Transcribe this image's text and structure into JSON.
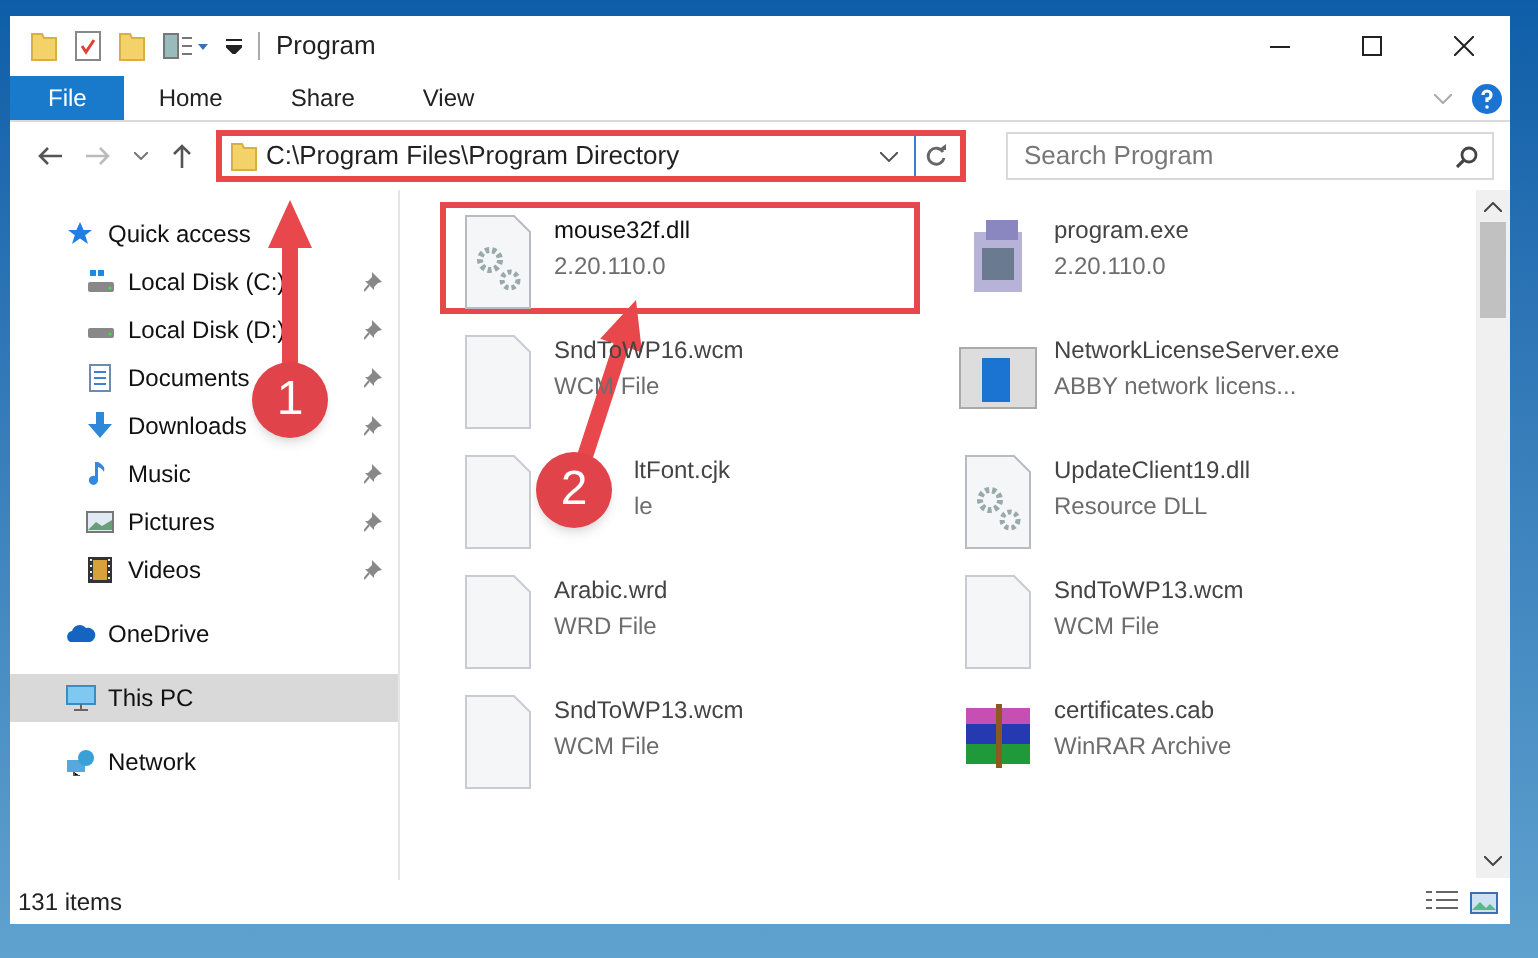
{
  "window": {
    "title": "Program"
  },
  "ribbon_tabs": [
    {
      "label": "File",
      "selected": true
    },
    {
      "label": "Home",
      "selected": false
    },
    {
      "label": "Share",
      "selected": false
    },
    {
      "label": "View",
      "selected": false
    }
  ],
  "address_bar": {
    "path": "C:\\Program Files\\Program Directory",
    "highlighted": true
  },
  "search": {
    "placeholder": "Search Program"
  },
  "sidebar": {
    "items": [
      {
        "label": "Quick access",
        "selected": false,
        "children": [
          {
            "label": "Local Disk (C:)",
            "pinned": true,
            "selected": false
          },
          {
            "label": "Local Disk (D:)",
            "pinned": true,
            "selected": false
          },
          {
            "label": "Documents",
            "pinned": true,
            "selected": false
          },
          {
            "label": "Downloads",
            "pinned": true,
            "selected": false
          },
          {
            "label": "Music",
            "pinned": true,
            "selected": false
          },
          {
            "label": "Pictures",
            "pinned": true,
            "selected": false
          },
          {
            "label": "Videos",
            "pinned": true,
            "selected": false
          }
        ]
      },
      {
        "label": "OneDrive",
        "selected": false
      },
      {
        "label": "This PC",
        "selected": true
      },
      {
        "label": "Network",
        "selected": false
      }
    ]
  },
  "files": [
    {
      "name": "mouse32f.dll",
      "detail": "2.20.110.0",
      "kind": "gearfile",
      "highlighted": true
    },
    {
      "name": "program.exe",
      "detail": "2.20.110.0",
      "kind": "app",
      "highlighted": false
    },
    {
      "name": "SndToWP16.wcm",
      "detail": "WCM File",
      "kind": "blank",
      "highlighted": false
    },
    {
      "name": "NetworkLicenseServer.exe",
      "detail": "ABBY network licens...",
      "kind": "window",
      "highlighted": false
    },
    {
      "name": "ltFont.cjk",
      "detail": "le",
      "kind": "covered",
      "highlighted": false
    },
    {
      "name": "UpdateClient19.dll",
      "detail": "Resource DLL",
      "kind": "gearfile",
      "highlighted": false
    },
    {
      "name": "Arabic.wrd",
      "detail": "WRD File",
      "kind": "blank",
      "highlighted": false
    },
    {
      "name": "SndToWP13.wcm",
      "detail": "WCM File",
      "kind": "blank",
      "highlighted": false
    },
    {
      "name": "SndToWP13.wcm",
      "detail": "WCM File",
      "kind": "blank",
      "highlighted": false
    },
    {
      "name": "certificates.cab",
      "detail": "WinRAR Archive",
      "kind": "archive",
      "highlighted": false
    }
  ],
  "status_bar": {
    "item_count": "131 items"
  },
  "annotations": [
    {
      "number": "1"
    },
    {
      "number": "2"
    }
  ]
}
